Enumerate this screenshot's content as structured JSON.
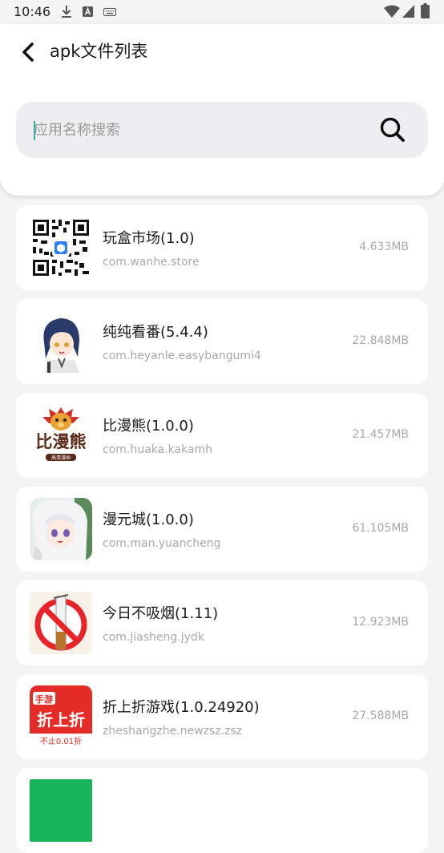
{
  "status_bar": {
    "time": "10:46"
  },
  "header": {
    "title": "apk文件列表"
  },
  "search": {
    "placeholder": "应用名称搜索",
    "value": ""
  },
  "apps": [
    {
      "name": "玩盒市场(1.0)",
      "package": "com.wanhe.store",
      "size": "4.633MB",
      "icon": "qr-code-icon"
    },
    {
      "name": "纯纯看番(5.4.4)",
      "package": "com.heyanle.easybangumi4",
      "size": "22.848MB",
      "icon": "anime-girl-icon"
    },
    {
      "name": "比漫熊(1.0.0)",
      "package": "com.huaka.kakamh",
      "size": "21.457MB",
      "icon": "bear-logo-icon"
    },
    {
      "name": "漫元城(1.0.0)",
      "package": "com.man.yuancheng",
      "size": "61.105MB",
      "icon": "white-hair-girl-icon"
    },
    {
      "name": "今日不吸烟(1.11)",
      "package": "com.jiasheng.jydk",
      "size": "12.923MB",
      "icon": "no-smoking-icon"
    },
    {
      "name": "折上折游戏(1.0.24920)",
      "package": "zheshangzhe.newzsz.zsz",
      "size": "27.588MB",
      "icon": "zheshangzhe-logo-icon"
    },
    {
      "name": "",
      "package": "",
      "size": "",
      "icon": "green-app-icon"
    }
  ],
  "icon_text": {
    "bear_logo": "比漫熊",
    "bear_logo_sub": "高清漫画",
    "zsz_badge": "手游",
    "zsz_main": "折上折",
    "zsz_sub": "不止0.01折"
  },
  "colors": {
    "background": "#f4f4f4",
    "card": "#ffffff",
    "search_bg": "#eeeef2",
    "cursor": "#2bb3a6",
    "secondary_text": "#a8a8a8"
  }
}
